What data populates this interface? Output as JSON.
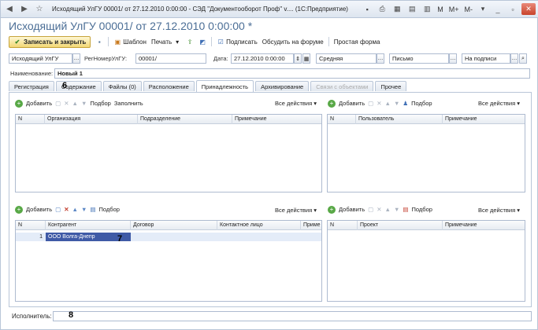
{
  "window": {
    "title": "Исходящий УлГУ 00001/ от 27.12.2010 0:00:00 - СЭД \"Документооборот Проф\" v.... (1С:Предприятие)",
    "right_text": [
      "M",
      "M+",
      "M-"
    ]
  },
  "document_title": "Исходящий УлГУ 00001/ от 27.12.2010 0:00:00 *",
  "toolbar": {
    "save_close": "Записать и закрыть",
    "template": "Шаблон",
    "print": "Печать",
    "sign": "Подписать",
    "discuss": "Обсудить на форуме",
    "simple_form": "Простая форма"
  },
  "fields": {
    "doc_type": "Исходящий УлГУ",
    "reg_label": "РегНомерУлГУ:",
    "reg_value": "00001/",
    "date_label": "Дата:",
    "date_value": "27.12.2010  0:00:00",
    "importance": "Средняя",
    "kind": "Письмо",
    "state": "На подписи",
    "name_label": "Наименование:",
    "name_value": "Новый 1"
  },
  "tabs": [
    {
      "label": "Регистрация"
    },
    {
      "label": "Содержание"
    },
    {
      "label": "Файлы (0)"
    },
    {
      "label": "Расположение"
    },
    {
      "label": "Принадлежность"
    },
    {
      "label": "Архивирование"
    },
    {
      "label": "Связи с объектами"
    },
    {
      "label": "Прочее"
    }
  ],
  "top_left_toolbar": {
    "add": "Добавить",
    "select": "Подбор",
    "fill": "Заполнить",
    "all_actions": "Все действия"
  },
  "top_right_toolbar": {
    "add": "Добавить",
    "select": "Подбор",
    "all_actions": "Все действия"
  },
  "bottom_left_toolbar": {
    "add": "Добавить",
    "select": "Подбор",
    "all_actions": "Все действия"
  },
  "bottom_right_toolbar": {
    "add": "Добавить",
    "select": "Подбор",
    "all_actions": "Все действия"
  },
  "grid_org": {
    "columns": [
      "N",
      "Организация",
      "Подразделение",
      "Примечание"
    ]
  },
  "grid_users": {
    "columns": [
      "N",
      "Пользователь",
      "Примечание"
    ]
  },
  "grid_contractors": {
    "columns": [
      "N",
      "Контрагент",
      "Договор",
      "Контактное лицо",
      "Приме"
    ],
    "rows": [
      {
        "n": "1",
        "contractor": "ООО Волга-Днепр"
      }
    ]
  },
  "grid_projects": {
    "columns": [
      "N",
      "Проект",
      "Примечание"
    ]
  },
  "footer": {
    "executor_label": "Исполнитель:"
  },
  "marks": {
    "six": "6",
    "seven": "7",
    "eight": "8"
  }
}
